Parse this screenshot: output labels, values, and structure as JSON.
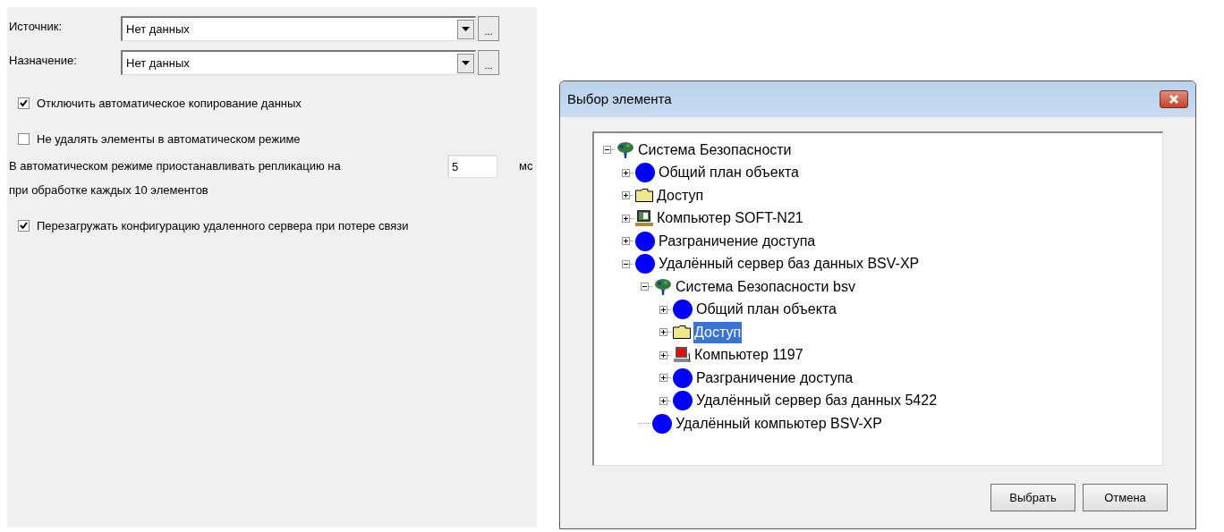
{
  "settings": {
    "fields": [
      {
        "label": "Источник:",
        "value": "Нет данных",
        "browse": "..."
      },
      {
        "label": "Назначение:",
        "value": "Нет данных",
        "browse": "..."
      }
    ],
    "options": [
      {
        "kind": "checkbox",
        "label": "Отключить автоматическое копирование данных",
        "checked": true
      },
      {
        "kind": "checkbox",
        "label": "Не удалять элементы в автоматическом режиме",
        "checked": false
      },
      {
        "kind": "pause",
        "label": "В автоматическом режиме приостанавливать репликацию на",
        "value": "5",
        "unit": "мс",
        "note": "при обработке каждых 10 элементов"
      },
      {
        "kind": "checkbox",
        "label": "Перезагружать конфигурацию удаленного сервера при потере связи",
        "checked": true
      }
    ]
  },
  "dialog": {
    "title": "Выбор элемента",
    "tree": [
      {
        "label": "Система Безопасности",
        "kind": "tree",
        "expander": true,
        "expanded": true,
        "selected": false,
        "children": [
          {
            "label": "Общий план объекта",
            "kind": "circle",
            "expander": true,
            "expanded": false,
            "selected": false
          },
          {
            "label": "Доступ",
            "kind": "folder",
            "expander": true,
            "expanded": false,
            "selected": false
          },
          {
            "label": "Компьютер SOFT-N21",
            "kind": "computer",
            "expander": true,
            "expanded": false,
            "selected": false
          },
          {
            "label": "Разграничение доступа",
            "kind": "circle",
            "expander": true,
            "expanded": false,
            "selected": false
          },
          {
            "label": "Удалённый сервер баз данных BSV-XP",
            "kind": "circle",
            "expander": true,
            "expanded": true,
            "selected": false,
            "children": [
              {
                "label": "Система Безопасности bsv",
                "kind": "tree",
                "expander": true,
                "expanded": true,
                "selected": false,
                "children": [
                  {
                    "label": "Общий план объекта",
                    "kind": "circle",
                    "expander": true,
                    "expanded": false,
                    "selected": false
                  },
                  {
                    "label": "Доступ",
                    "kind": "folder",
                    "expander": true,
                    "expanded": false,
                    "selected": true
                  },
                  {
                    "label": "Компьютер 1197",
                    "kind": "computer-alert",
                    "expander": true,
                    "expanded": false,
                    "selected": false
                  },
                  {
                    "label": "Разграничение доступа",
                    "kind": "circle",
                    "expander": true,
                    "expanded": false,
                    "selected": false
                  },
                  {
                    "label": "Удалённый сервер баз данных 5422",
                    "kind": "circle",
                    "expander": true,
                    "expanded": false,
                    "selected": false
                  }
                ]
              },
              {
                "label": "Удалённый компьютер BSV-XP",
                "kind": "circle",
                "expander": false,
                "selected": false
              }
            ]
          }
        ]
      }
    ],
    "buttons": [
      "Выбрать",
      "Отмена"
    ]
  }
}
